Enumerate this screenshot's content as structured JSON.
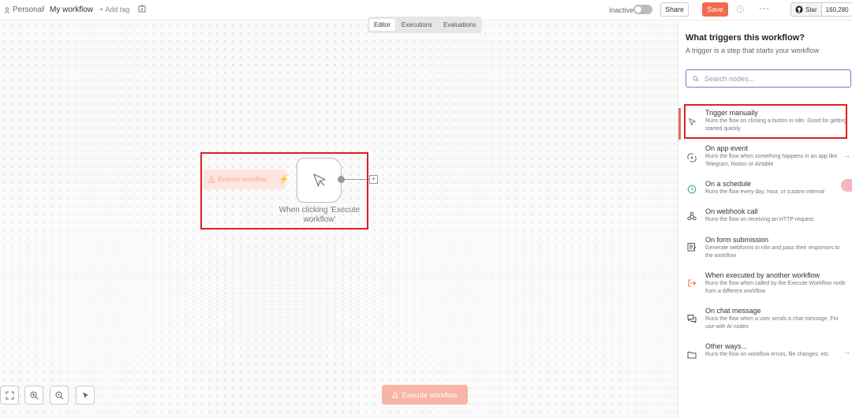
{
  "header": {
    "breadcrumb_personal": "Personal",
    "breadcrumb_sep": "/",
    "workflow_title": "My workflow",
    "add_tag": "+ Add tag",
    "inactive_label": "Inactive",
    "share_label": "Share",
    "save_label": "Save",
    "more_label": "···",
    "star_label": "Star",
    "star_count": "160,280"
  },
  "tabs": [
    {
      "label": "Editor",
      "active": true
    },
    {
      "label": "Executions",
      "active": false
    },
    {
      "label": "Evaluations",
      "active": false
    }
  ],
  "canvas": {
    "ghost_execute_label": "Execute workflow",
    "node_label": "When clicking 'Execute workflow'",
    "plus_label": "+",
    "execute_button_label": "Execute workflow",
    "zoom_controls": [
      "fit-view-icon",
      "zoom-in-icon",
      "zoom-out-icon",
      "select-pointer-icon"
    ]
  },
  "panel": {
    "title": "What triggers this workflow?",
    "subtitle": "A trigger is a step that starts your workflow",
    "search_placeholder": "Search nodes...",
    "triggers": [
      {
        "icon": "cursor-icon",
        "name": "Trigger manually",
        "description": "Runs the flow on clicking a button in n8n. Good for getting started quickly",
        "arrow": false,
        "highlighted": true
      },
      {
        "icon": "app-event-icon",
        "name": "On app event",
        "description": "Runs the flow when something happens in an app like Telegram, Notion or Airtable",
        "arrow": true
      },
      {
        "icon": "clock-icon",
        "name": "On a schedule",
        "description": "Runs the flow every day, hour, or custom interval",
        "arrow": false
      },
      {
        "icon": "webhook-icon",
        "name": "On webhook call",
        "description": "Runs the flow on receiving an HTTP request",
        "arrow": false
      },
      {
        "icon": "form-icon",
        "name": "On form submission",
        "description": "Generate webforms in n8n and pass their responses to the workflow",
        "arrow": false
      },
      {
        "icon": "sign-in-icon",
        "name": "When executed by another workflow",
        "description": "Runs the flow when called by the Execute Workflow node from a different workflow",
        "arrow": false
      },
      {
        "icon": "chat-icon",
        "name": "On chat message",
        "description": "Runs the flow when a user sends a chat message. For use with AI nodes",
        "arrow": false
      },
      {
        "icon": "folder-icon",
        "name": "Other ways...",
        "description": "Runs the flow on workflow errors, file changes, etc.",
        "arrow": true
      }
    ]
  },
  "colors": {
    "accent": "#f2694c",
    "highlight_border": "#e02020",
    "search_border": "#7a78c8"
  }
}
